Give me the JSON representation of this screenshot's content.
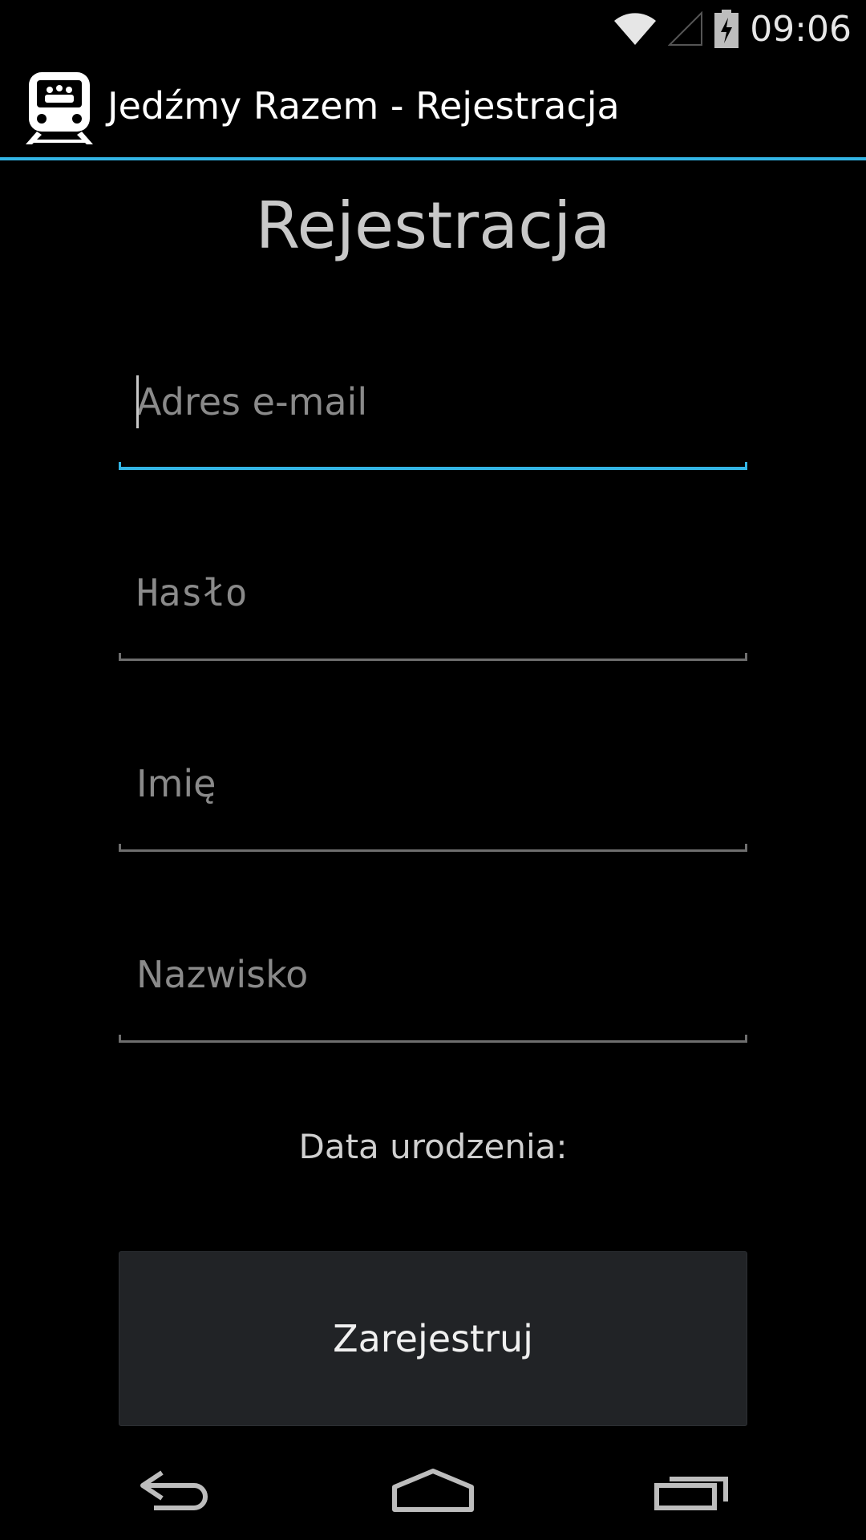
{
  "status_bar": {
    "time": "09:06",
    "icons": [
      "wifi-icon",
      "signal-icon",
      "battery-charging-icon"
    ]
  },
  "action_bar": {
    "app_icon": "train-icon",
    "title": "Jedźmy Razem - Rejestracja"
  },
  "page": {
    "title": "Rejestracja"
  },
  "form": {
    "email_placeholder": "Adres e-mail",
    "email_value": "",
    "password_placeholder": "Hasło",
    "password_value": "",
    "first_name_placeholder": "Imię",
    "first_name_value": "",
    "last_name_placeholder": "Nazwisko",
    "last_name_value": "",
    "dob_label": "Data urodzenia:",
    "submit_label": "Zarejestruj"
  },
  "nav_bar": {
    "buttons": [
      "back-icon",
      "home-icon",
      "recent-apps-icon"
    ]
  },
  "colors": {
    "accent": "#33b5e5",
    "background": "#000000",
    "button": "#212326"
  }
}
